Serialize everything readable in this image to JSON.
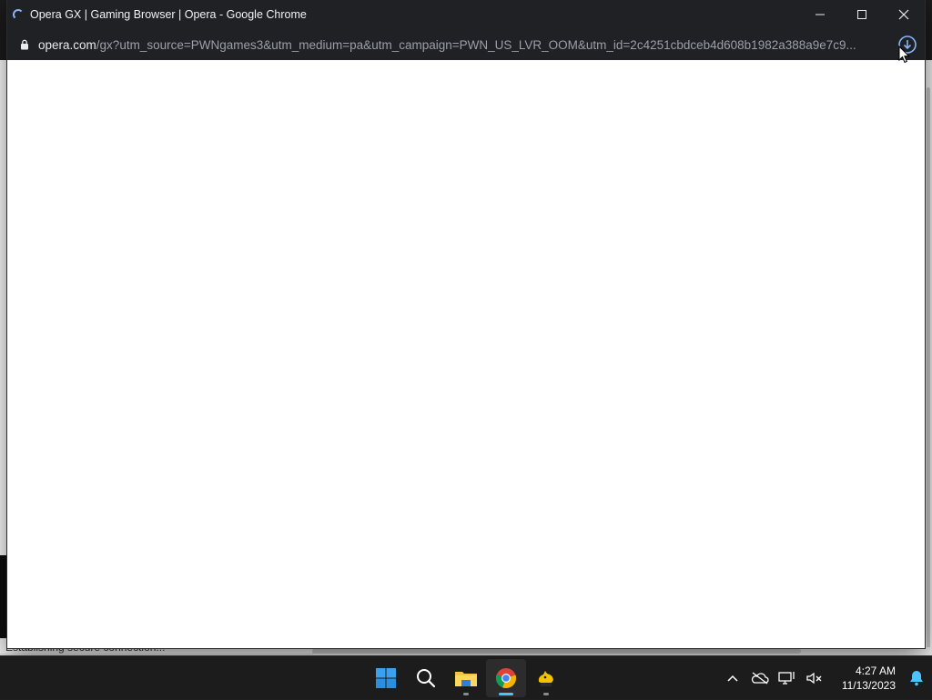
{
  "popup": {
    "title": "Opera GX | Gaming Browser | Opera - Google Chrome",
    "url_host": "opera.com",
    "url_path": "/gx?utm_source=PWNgames3&utm_medium=pa&utm_campaign=PWN_US_LVR_OOM&utm_id=2c4251cbdceb4d608b1982a388a9e7c9...",
    "icons": {
      "loading": "loading-spinner-icon",
      "minimize": "minimize-icon",
      "maximize": "maximize-icon",
      "close": "close-icon",
      "lock": "lock-icon",
      "download": "download-icon"
    }
  },
  "background": {
    "status_text": "Establishing secure connection..."
  },
  "taskbar": {
    "apps": [
      {
        "name": "start",
        "icon": "windows-start-icon"
      },
      {
        "name": "search",
        "icon": "search-icon"
      },
      {
        "name": "file-explorer",
        "icon": "folder-icon"
      },
      {
        "name": "chrome",
        "icon": "chrome-icon",
        "active": true
      },
      {
        "name": "game",
        "icon": "game-app-icon"
      }
    ],
    "tray": {
      "icons": [
        "chevron-up-icon",
        "onedrive-offline-icon",
        "display-network-icon",
        "volume-muted-icon"
      ],
      "time": "4:27 AM",
      "date": "11/13/2023",
      "notification_icon": "notification-bell-icon"
    }
  },
  "colors": {
    "titlebar": "#202124",
    "taskbar": "#1c1c1c",
    "accent": "#4cc2ff",
    "spinner": "#8ab4f8"
  }
}
